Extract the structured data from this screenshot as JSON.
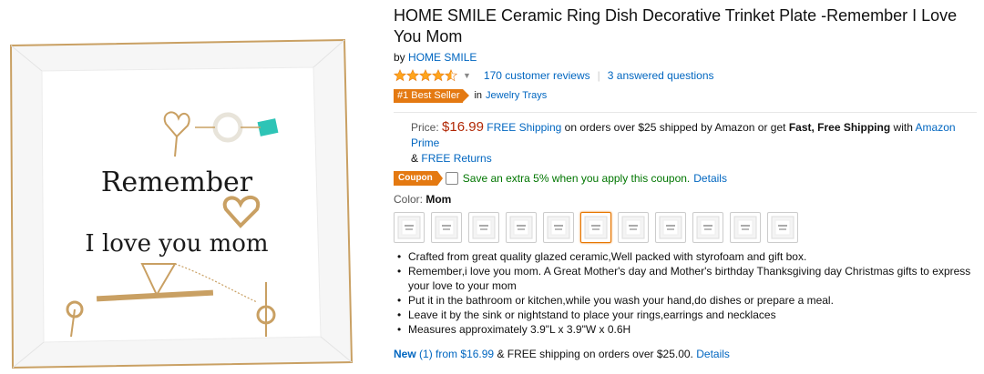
{
  "product": {
    "title": "HOME SMILE Ceramic Ring Dish Decorative Trinket Plate -Remember I Love You Mom",
    "by_prefix": "by",
    "brand": "HOME SMILE",
    "rating_stars": 4.5,
    "reviews_link": "170 customer reviews",
    "separator": "|",
    "questions_link": "3 answered questions",
    "best_seller_badge": "#1 Best Seller",
    "best_seller_in": "in",
    "best_seller_category": "Jewelry Trays",
    "image": {
      "line1": "Remember",
      "line2": "I love you mom"
    }
  },
  "price": {
    "label": "Price:",
    "amount": "$16.99",
    "free_shipping": "FREE Shipping",
    "shipping_text": "on orders over $25 shipped by Amazon or get",
    "fast_free": "Fast, Free Shipping",
    "with_text": "with",
    "prime": "Amazon Prime",
    "amp": "&",
    "free_returns": "FREE Returns"
  },
  "coupon": {
    "badge": "Coupon",
    "text": "Save an extra 5% when you apply this coupon.",
    "details": "Details"
  },
  "color": {
    "label": "Color:",
    "value": "Mom",
    "swatch_count": 11,
    "selected_index": 5
  },
  "bullets": [
    "Crafted from great quality glazed ceramic,Well packed with styrofoam and gift box.",
    "Remember,i love you mom. A Great Mother's day and Mother's birthday Thanksgiving day Christmas gifts to express your love to your mom",
    "Put it in the bathroom or kitchen,while you wash your hand,do dishes or prepare a meal.",
    "Leave it by the sink or nightstand to place your rings,earrings and necklaces",
    "Measures approximately 3.9\"L x 3.9\"W x 0.6H"
  ],
  "offers": {
    "new_label": "New",
    "count": "(1)",
    "from_text": "from",
    "price": "$16.99",
    "shipping_text": "& FREE shipping on orders over $25.00.",
    "details": "Details"
  },
  "colors": {
    "link": "#0066c0",
    "price": "#b12704",
    "badge": "#e47911",
    "coupon_text": "#007600",
    "star": "#ffa41c"
  }
}
